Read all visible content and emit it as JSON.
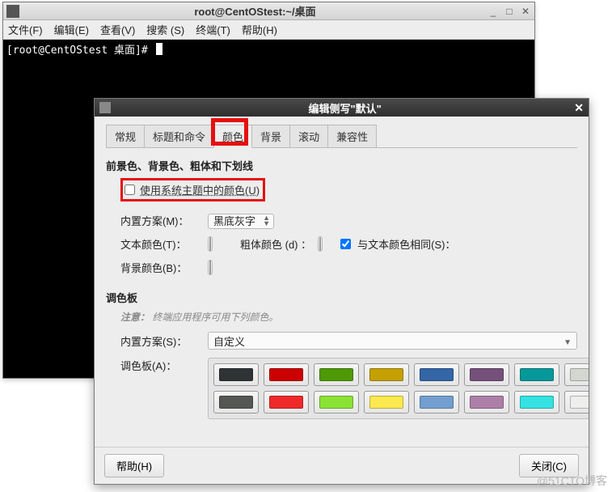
{
  "terminal": {
    "title": "root@CentOStest:~/桌面",
    "menus": [
      "文件(F)",
      "编辑(E)",
      "查看(V)",
      "搜索 (S)",
      "终端(T)",
      "帮助(H)"
    ],
    "prompt": "[root@CentOStest 桌面]# "
  },
  "dialog": {
    "title": "编辑侧写\"默认\"",
    "tabs": [
      "常规",
      "标题和命令",
      "颜色",
      "背景",
      "滚动",
      "兼容性"
    ],
    "active_tab_index": 2,
    "section_fg_bg": "前景色、背景色、粗体和下划线",
    "use_theme_checkbox_label": "使用系统主题中的颜色(U)",
    "builtin_scheme_label": "内置方案(M)：",
    "builtin_scheme_value": "黑底灰字",
    "text_color_label": "文本颜色(T)：",
    "bold_color_label": "粗体颜色 (d) ：",
    "same_as_text_label": "与文本颜色相同(S)：",
    "same_as_text_checked": true,
    "bg_color_label": "背景颜色(B)：",
    "palette_title": "调色板",
    "note_prefix": "注意：",
    "note_text": "终端应用程序可用下列颜色。",
    "palette_scheme_label": "内置方案(S)：",
    "palette_scheme_value": "自定义",
    "palette_row_label": "调色板(A)：",
    "palette_colors": [
      "#2e3436",
      "#cc0000",
      "#4e9a06",
      "#c4a000",
      "#3465a4",
      "#75507b",
      "#06989a",
      "#d3d7cf",
      "#555753",
      "#ef2929",
      "#8ae234",
      "#fce94f",
      "#729fcf",
      "#ad7fa8",
      "#34e2e2",
      "#eeeeec"
    ],
    "help_btn": "帮助(H)",
    "close_btn": "关闭(C)"
  },
  "watermark": "@51CTO博客",
  "colors": {
    "text_swatch": "#808080",
    "bg_swatch": "#000000"
  }
}
